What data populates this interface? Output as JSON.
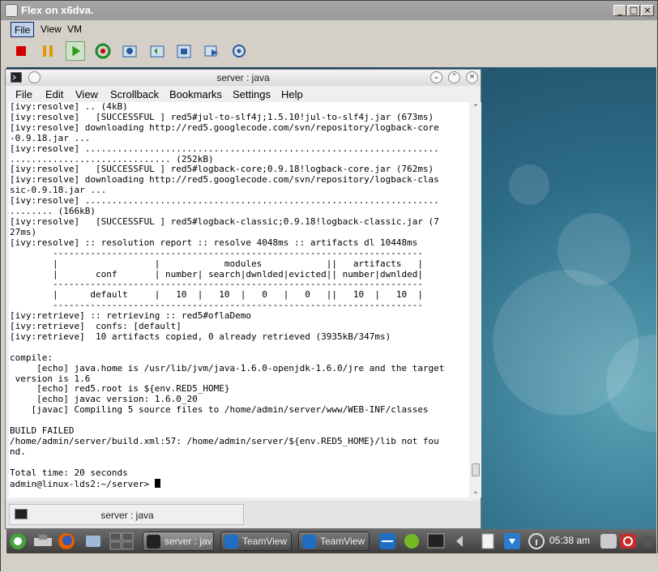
{
  "outer_window": {
    "title": "Flex on x6dva.",
    "controls": [
      "_",
      "□",
      "×"
    ]
  },
  "menubar": {
    "items": [
      "File",
      "View",
      "VM"
    ]
  },
  "toolbar": {
    "buttons": [
      "stop-icon",
      "pause-icon",
      "play-icon",
      "reset-icon",
      "snapshot-icon",
      "revert-snapshot-icon",
      "manage-snapshots-icon",
      "send-keys-icon",
      "settings-icon"
    ]
  },
  "terminal": {
    "title": "server : java",
    "controls": [
      "⌄",
      "⌃",
      "×"
    ],
    "menu": [
      "File",
      "Edit",
      "View",
      "Scrollback",
      "Bookmarks",
      "Settings",
      "Help"
    ],
    "lines": [
      "[ivy:resolve] .. (4kB)",
      "[ivy:resolve]   [SUCCESSFUL ] red5#jul-to-slf4j;1.5.10!jul-to-slf4j.jar (673ms)",
      "[ivy:resolve] downloading http://red5.googlecode.com/svn/repository/logback-core",
      "-0.9.18.jar ...",
      "[ivy:resolve] ..................................................................",
      ".............................. (252kB)",
      "[ivy:resolve]   [SUCCESSFUL ] red5#logback-core;0.9.18!logback-core.jar (762ms)",
      "[ivy:resolve] downloading http://red5.googlecode.com/svn/repository/logback-clas",
      "sic-0.9.18.jar ...",
      "[ivy:resolve] ..................................................................",
      "........ (166kB)",
      "[ivy:resolve]   [SUCCESSFUL ] red5#logback-classic;0.9.18!logback-classic.jar (7",
      "27ms)",
      "[ivy:resolve] :: resolution report :: resolve 4048ms :: artifacts dl 10448ms",
      "        ---------------------------------------------------------------------",
      "        |                  |            modules            ||   artifacts   |",
      "        |       conf       | number| search|dwnlded|evicted|| number|dwnlded|",
      "        ---------------------------------------------------------------------",
      "        |      default     |   10  |   10  |   0   |   0   ||   10  |   10  |",
      "        ---------------------------------------------------------------------",
      "[ivy:retrieve] :: retrieving :: red5#oflaDemo",
      "[ivy:retrieve]  confs: [default]",
      "[ivy:retrieve]  10 artifacts copied, 0 already retrieved (3935kB/347ms)",
      "",
      "compile:",
      "     [echo] java.home is /usr/lib/jvm/java-1.6.0-openjdk-1.6.0/jre and the target",
      " version is 1.6",
      "     [echo] red5.root is ${env.RED5_HOME}",
      "     [echo] javac version: 1.6.0_20",
      "    [javac] Compiling 5 source files to /home/admin/server/www/WEB-INF/classes",
      "",
      "BUILD FAILED",
      "/home/admin/server/build.xml:57: /home/admin/server/${env.RED5_HOME}/lib not fou",
      "nd.",
      "",
      "Total time: 20 seconds"
    ],
    "prompt": "admin@linux-lds2:~/server> ",
    "tab_label": "server : java"
  },
  "taskbar": {
    "tasks": [
      {
        "label": "server : jav",
        "icon": "terminal-icon"
      },
      {
        "label": "TeamView",
        "icon": "teamviewer-icon"
      },
      {
        "label": "TeamView",
        "icon": "teamviewer-icon"
      }
    ],
    "clock": "05:38 am"
  },
  "colors": {
    "desktop": "#2d6d88",
    "accent": "#0a246a"
  }
}
